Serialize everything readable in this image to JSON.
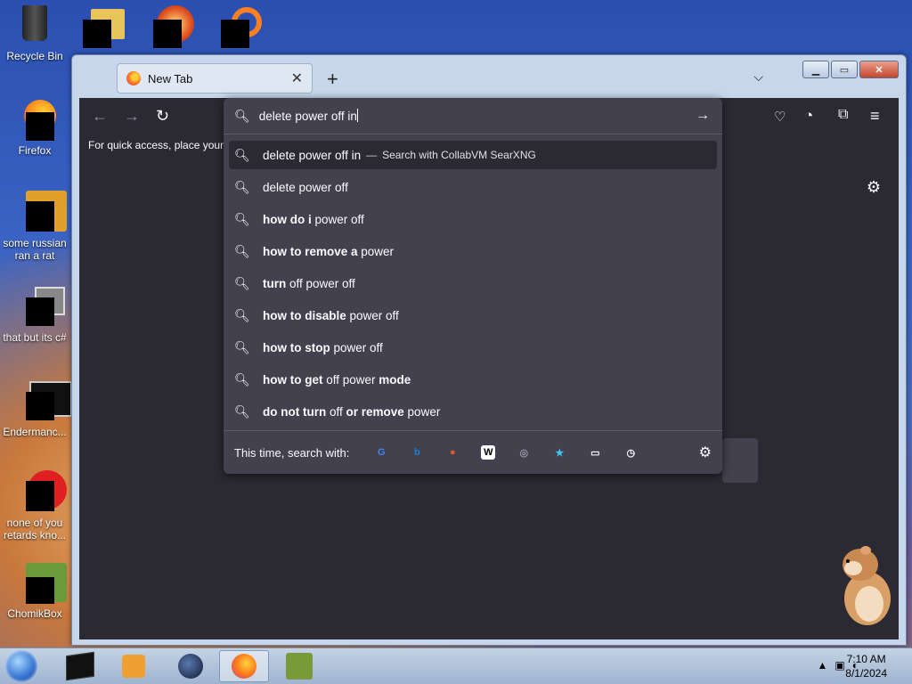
{
  "desktop": {
    "icons": [
      {
        "label": "Recycle Bin"
      },
      {
        "label": "Firefox"
      },
      {
        "label": "some russian ran a rat"
      },
      {
        "label": "that but its c#"
      },
      {
        "label": "Endermanc..."
      },
      {
        "label": "none of you retards kno..."
      },
      {
        "label": "ChomikBox"
      }
    ]
  },
  "browser": {
    "tab_title": "New Tab",
    "new_tab_symbol": "+",
    "bookmarks_hint": "For quick access, place your b",
    "urlbar": {
      "query": "delete power off in",
      "first_row": {
        "query": "delete power off in",
        "separator": "—",
        "engine_label": "Search with CollabVM SearXNG"
      },
      "suggestions": [
        {
          "parts": [
            {
              "t": "delete power off",
              "b": false
            }
          ]
        },
        {
          "parts": [
            {
              "t": "how do i",
              "b": true
            },
            {
              "t": " power off",
              "b": false
            }
          ]
        },
        {
          "parts": [
            {
              "t": "how to remove a",
              "b": true
            },
            {
              "t": " power",
              "b": false
            }
          ]
        },
        {
          "parts": [
            {
              "t": "turn",
              "b": true
            },
            {
              "t": " off power off",
              "b": false
            }
          ]
        },
        {
          "parts": [
            {
              "t": "how to disable",
              "b": true
            },
            {
              "t": " power off",
              "b": false
            }
          ]
        },
        {
          "parts": [
            {
              "t": "how to stop",
              "b": true
            },
            {
              "t": " power off",
              "b": false
            }
          ]
        },
        {
          "parts": [
            {
              "t": "how to get",
              "b": true
            },
            {
              "t": " off power ",
              "b": false
            },
            {
              "t": "mode",
              "b": true
            }
          ]
        },
        {
          "parts": [
            {
              "t": "do not turn",
              "b": true
            },
            {
              "t": " off ",
              "b": false
            },
            {
              "t": "or remove",
              "b": true
            },
            {
              "t": " power",
              "b": false
            }
          ]
        }
      ],
      "footer_label": "This time, search with:",
      "engines": [
        {
          "name": "google",
          "glyph": "G",
          "color": "#4285f4"
        },
        {
          "name": "bing",
          "glyph": "b",
          "color": "#1a7fd4"
        },
        {
          "name": "duckduckgo",
          "glyph": "●",
          "color": "#de5833"
        },
        {
          "name": "wikipedia",
          "glyph": "W",
          "color": "#000000"
        },
        {
          "name": "searxng",
          "glyph": "◎",
          "color": "#9a9aa8"
        },
        {
          "name": "bookmarks",
          "glyph": "★",
          "color": "#3fc7f5"
        },
        {
          "name": "tabs",
          "glyph": "▭",
          "color": "#fbfbfe"
        },
        {
          "name": "history",
          "glyph": "◷",
          "color": "#fbfbfe"
        }
      ]
    }
  },
  "taskbar": {
    "time": "7:10 AM",
    "date": "8/1/2024"
  },
  "colors": {
    "browser_bg": "#2b2a33",
    "panel_bg": "#42414d",
    "text": "#fbfbfe"
  }
}
